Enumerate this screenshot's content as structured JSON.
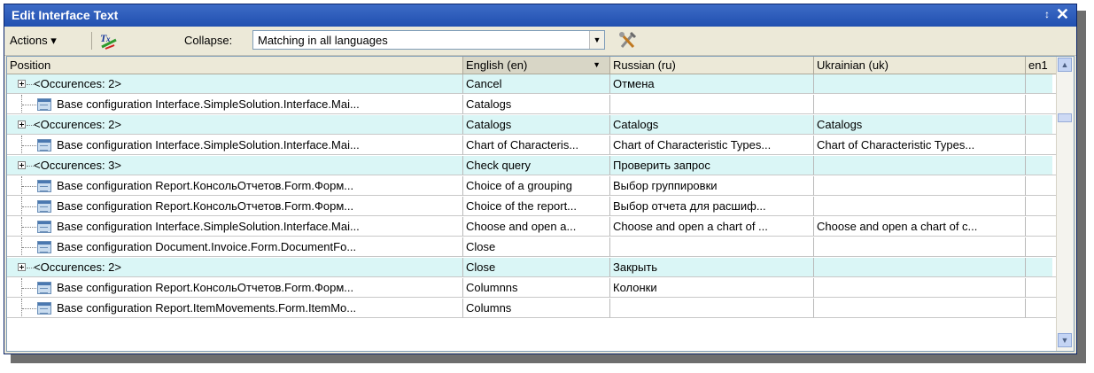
{
  "window": {
    "title": "Edit Interface Text",
    "pin_glyph": "↕",
    "close_glyph": "✕"
  },
  "toolbar": {
    "actions_label": "Actions ▾",
    "collapse_label": "Collapse:",
    "collapse_value": "Matching in all languages",
    "dropdown_glyph": "▼"
  },
  "grid": {
    "columns": [
      "Position",
      "English (en)",
      "Russian (ru)",
      "Ukrainian (uk)",
      "en1"
    ],
    "sort_glyph": "▼",
    "rows": [
      {
        "type": "group",
        "position": "<Occurences: 2>",
        "en": "Cancel",
        "ru": "Отмена",
        "uk": ""
      },
      {
        "type": "item",
        "position": "Base configuration Interface.SimpleSolution.Interface.Mai...",
        "en": "Catalogs",
        "ru": "",
        "uk": ""
      },
      {
        "type": "group",
        "position": "<Occurences: 2>",
        "en": "Catalogs",
        "ru": "Catalogs",
        "uk": "Catalogs"
      },
      {
        "type": "item",
        "position": "Base configuration Interface.SimpleSolution.Interface.Mai...",
        "en": "Chart of Characteris...",
        "ru": "Chart of Characteristic Types...",
        "uk": "Chart of Characteristic Types..."
      },
      {
        "type": "group",
        "position": "<Occurences: 3>",
        "en": "Check query",
        "ru": "Проверить запрос",
        "uk": ""
      },
      {
        "type": "item",
        "position": "Base configuration Report.КонсольОтчетов.Form.Форм...",
        "en": "Choice of a grouping",
        "ru": "Выбор группировки",
        "uk": ""
      },
      {
        "type": "item",
        "position": "Base configuration Report.КонсольОтчетов.Form.Форм...",
        "en": "Choice of the report...",
        "ru": "Выбор отчета для расшиф...",
        "uk": ""
      },
      {
        "type": "item",
        "position": "Base configuration Interface.SimpleSolution.Interface.Mai...",
        "en": "Choose and open a...",
        "ru": "Choose and open a chart of ...",
        "uk": "Choose and open a chart of c..."
      },
      {
        "type": "item",
        "position": "Base configuration Document.Invoice.Form.DocumentFo...",
        "en": "Close",
        "ru": "",
        "uk": ""
      },
      {
        "type": "group",
        "position": "<Occurences: 2>",
        "en": "Close",
        "ru": "Закрыть",
        "uk": ""
      },
      {
        "type": "item",
        "position": "Base configuration Report.КонсольОтчетов.Form.Форм...",
        "en": "Columnns",
        "ru": "Колонки",
        "uk": ""
      },
      {
        "type": "item",
        "position": "Base configuration Report.ItemMovements.Form.ItemMo...",
        "en": "Columns",
        "ru": "",
        "uk": ""
      }
    ]
  },
  "scrollbar": {
    "up_glyph": "▲",
    "down_glyph": "▼"
  },
  "colors": {
    "title_bar": "#2a58b8",
    "group_row": "#daf6f6",
    "window_bg": "#ece9d8"
  },
  "icons": {
    "translate": "translate-icon",
    "tools": "tools-icon",
    "form": "form-icon",
    "expand": "expand-icon"
  }
}
